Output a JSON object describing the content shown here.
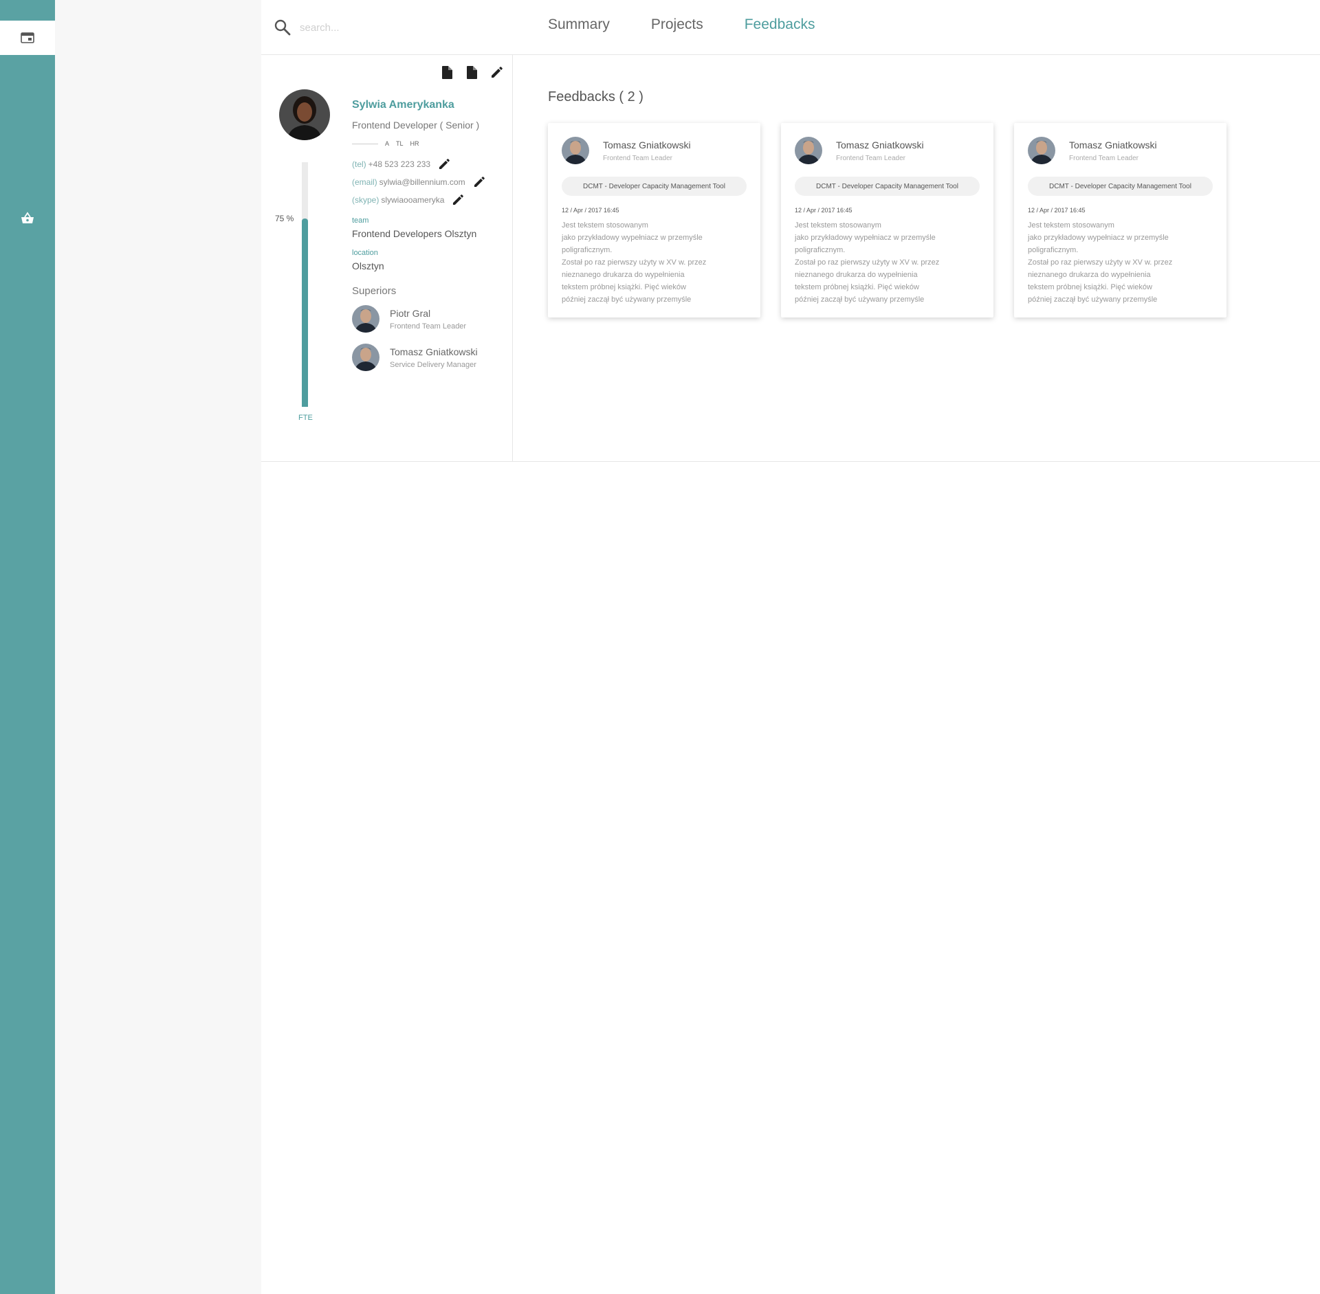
{
  "colors": {
    "accent": "#4e9d9e",
    "rail": "#5aa2a3"
  },
  "rail": {
    "items": [
      {
        "icon": "browser-window-icon",
        "active": true
      },
      {
        "icon": "basket-icon",
        "active": false
      }
    ]
  },
  "search": {
    "placeholder": "search..."
  },
  "tabs": [
    {
      "label": "Summary",
      "active": false
    },
    {
      "label": "Projects",
      "active": false
    },
    {
      "label": "Feedbacks",
      "active": true
    }
  ],
  "profile": {
    "tools": [
      "document-icon",
      "document-icon",
      "pencil-icon"
    ],
    "name": "Sylwia Amerykanka",
    "role": "Frontend Developer ( Senior )",
    "badges": [
      "A",
      "TL",
      "HR"
    ],
    "contacts": [
      {
        "key": "(tel)",
        "value": "+48 523 223 233"
      },
      {
        "key": "(email)",
        "value": "sylwia@billennium.com"
      },
      {
        "key": "(skype)",
        "value": "slywiaooameryka"
      }
    ],
    "team_label": "team",
    "team": "Frontend Developers Olsztyn",
    "location_label": "location",
    "location": "Olsztyn",
    "fte_percent_label": "75 %",
    "fte_fraction": 0.77,
    "fte_label": "FTE",
    "superiors_title": "Superiors",
    "superiors": [
      {
        "name": "Piotr Gral",
        "role": "Frontend Team Leader"
      },
      {
        "name": "Tomasz Gniatkowski",
        "role": "Service Delivery Manager"
      }
    ]
  },
  "feedbacks": {
    "title": "Feedbacks ( 2 )",
    "items": [
      {
        "author": "Tomasz Gniatkowski",
        "author_role": "Frontend Team Leader",
        "project": "DCMT - Developer Capacity Management Tool",
        "date": "12 / Apr / 2017 16:45",
        "text": "Jest tekstem stosowanym\njako przykładowy wypełniacz w przemyśle\npoligraficznym.\nZostał po raz pierwszy użyty w XV w. przez\nnieznanego drukarza do wypełnienia\ntekstem próbnej książki. Pięć wieków\npóźniej zaczął być używany przemyśle"
      },
      {
        "author": "Tomasz Gniatkowski",
        "author_role": "Frontend Team Leader",
        "project": "DCMT - Developer Capacity Management Tool",
        "date": "12 / Apr / 2017 16:45",
        "text": "Jest tekstem stosowanym\njako przykładowy wypełniacz w przemyśle\npoligraficznym.\nZostał po raz pierwszy użyty w XV w. przez\nnieznanego drukarza do wypełnienia\ntekstem próbnej książki. Pięć wieków\npóźniej zaczął być używany przemyśle"
      },
      {
        "author": "Tomasz Gniatkowski",
        "author_role": "Frontend Team Leader",
        "project": "DCMT - Developer Capacity Management Tool",
        "date": "12 / Apr / 2017 16:45",
        "text": "Jest tekstem stosowanym\njako przykładowy wypełniacz w przemyśle\npoligraficznym.\nZostał po raz pierwszy użyty w XV w. przez\nnieznanego drukarza do wypełnienia\ntekstem próbnej książki. Pięć wieków\npóźniej zaczął być używany przemyśle"
      }
    ]
  }
}
